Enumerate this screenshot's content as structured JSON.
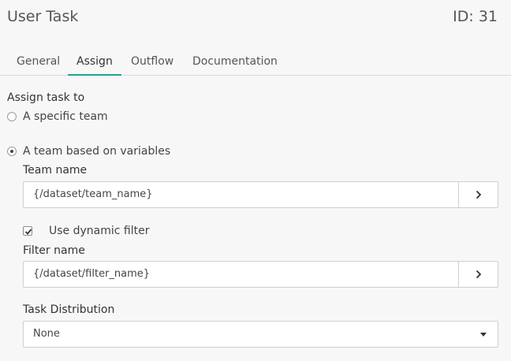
{
  "header": {
    "title": "User Task",
    "id_label": "ID: 31"
  },
  "tabs": [
    {
      "label": "General",
      "active": false
    },
    {
      "label": "Assign",
      "active": true
    },
    {
      "label": "Outflow",
      "active": false
    },
    {
      "label": "Documentation",
      "active": false
    }
  ],
  "assign": {
    "section_label": "Assign task to",
    "options": [
      {
        "label": "A specific team",
        "selected": false
      },
      {
        "label": "A team based on variables",
        "selected": true
      }
    ],
    "team_name": {
      "label": "Team name",
      "value": "{/dataset/team_name}",
      "button_icon": "chevron-right-icon"
    },
    "dynamic_filter": {
      "label": "Use dynamic filter",
      "checked": true
    },
    "filter_name": {
      "label": "Filter name",
      "value": "{/dataset/filter_name}",
      "button_icon": "chevron-right-icon"
    },
    "task_distribution": {
      "label": "Task Distribution",
      "selected": "None",
      "caret_icon": "caret-down-icon"
    }
  },
  "colors": {
    "accent": "#2a9d8f",
    "background": "#f7f7f7",
    "border": "#cfcfcf"
  }
}
